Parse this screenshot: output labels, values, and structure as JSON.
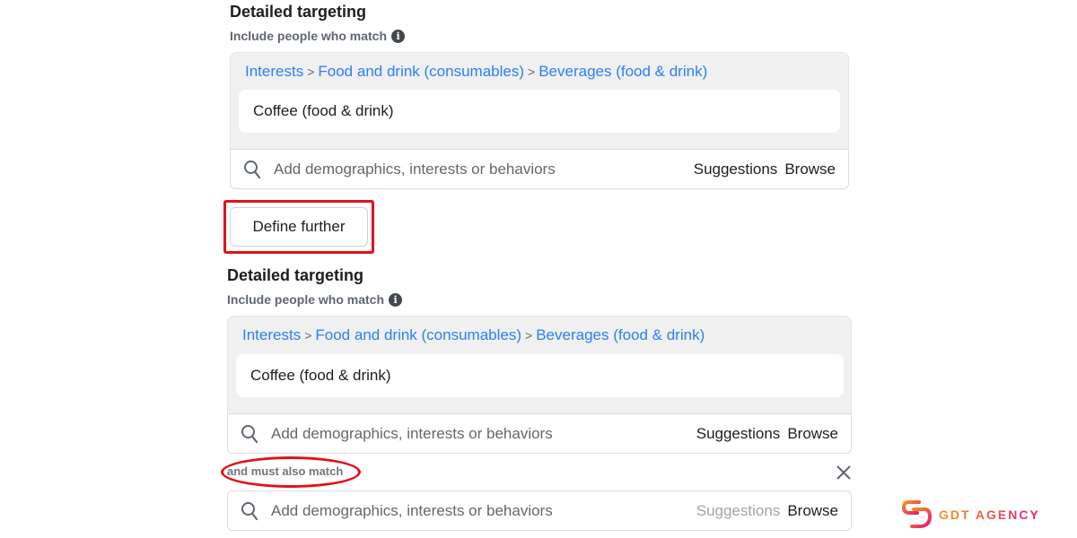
{
  "section1": {
    "title": "Detailed targeting",
    "subtitle": "Include people who match",
    "breadcrumb": [
      "Interests",
      "Food and drink (consumables)",
      "Beverages (food & drink)"
    ],
    "breadcrumb_separator": ">",
    "selected_item": "Coffee (food & drink)",
    "search_placeholder": "Add demographics, interests or behaviors",
    "suggestions_label": "Suggestions",
    "browse_label": "Browse"
  },
  "define_further_label": "Define further",
  "section2": {
    "title": "Detailed targeting",
    "subtitle": "Include people who match",
    "breadcrumb": [
      "Interests",
      "Food and drink (consumables)",
      "Beverages (food & drink)"
    ],
    "breadcrumb_separator": ">",
    "selected_item": "Coffee (food & drink)",
    "search_placeholder": "Add demographics, interests or behaviors",
    "suggestions_label": "Suggestions",
    "browse_label": "Browse"
  },
  "narrow": {
    "label": "and must also match",
    "search_placeholder": "Add demographics, interests or behaviors",
    "suggestions_label": "Suggestions",
    "browse_label": "Browse"
  },
  "logo": {
    "text": "GDT AGENCY"
  },
  "colors": {
    "link": "#2d7ff9",
    "highlight": "#e0121a",
    "logo_start": "#f7941d",
    "logo_end": "#e5197d"
  }
}
